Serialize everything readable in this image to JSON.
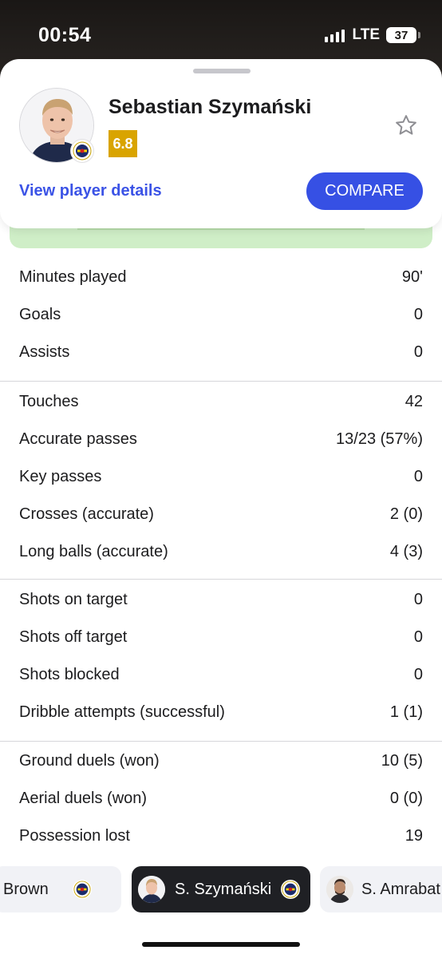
{
  "status_bar": {
    "time": "00:54",
    "network": "LTE",
    "battery": "37"
  },
  "player": {
    "name": "Sebastian Szymański",
    "rating": "6.8",
    "rating_color": "#d9a400",
    "favorite_icon": "star-outline-icon",
    "details_link": "View player details",
    "compare_label": "COMPARE"
  },
  "stats": {
    "groups": [
      [
        {
          "label": "Minutes played",
          "value": "90'"
        },
        {
          "label": "Goals",
          "value": "0"
        },
        {
          "label": "Assists",
          "value": "0"
        }
      ],
      [
        {
          "label": "Touches",
          "value": "42"
        },
        {
          "label": "Accurate passes",
          "value": "13/23 (57%)"
        },
        {
          "label": "Key passes",
          "value": "0"
        },
        {
          "label": "Crosses (accurate)",
          "value": "2 (0)"
        },
        {
          "label": "Long balls (accurate)",
          "value": "4 (3)"
        }
      ],
      [
        {
          "label": "Shots on target",
          "value": "0"
        },
        {
          "label": "Shots off target",
          "value": "0"
        },
        {
          "label": "Shots blocked",
          "value": "0"
        },
        {
          "label": "Dribble attempts (successful)",
          "value": "1 (1)"
        }
      ],
      [
        {
          "label": "Ground duels (won)",
          "value": "10 (5)"
        },
        {
          "label": "Aerial duels (won)",
          "value": "0 (0)"
        },
        {
          "label": "Possession lost",
          "value": "19"
        }
      ]
    ]
  },
  "carousel": {
    "prev_player": "Brown",
    "current_player": "S. Szymański",
    "next_player": "S. Amrabat"
  },
  "colors": {
    "accent": "#3650e4",
    "link": "#3b53e6",
    "heatmap": "#cfeec7"
  }
}
